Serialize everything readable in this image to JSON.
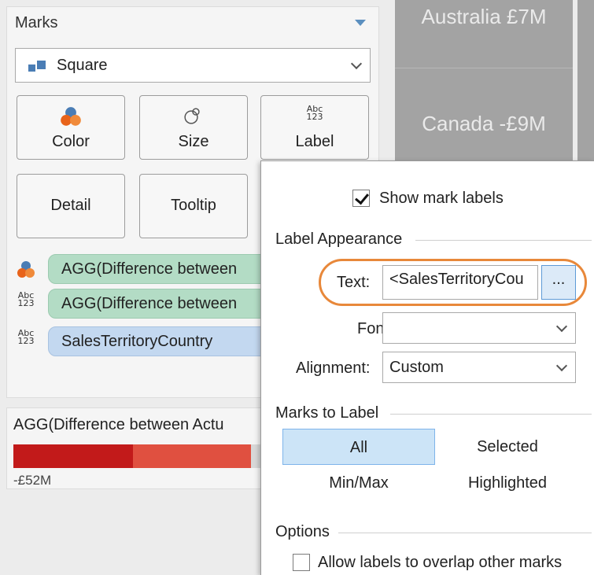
{
  "marks_card": {
    "title": "Marks",
    "mark_type": "Square",
    "buttons": {
      "color": "Color",
      "size": "Size",
      "label": "Label",
      "detail": "Detail",
      "tooltip": "Tooltip"
    },
    "pills": [
      "AGG(Difference between",
      "AGG(Difference between",
      "SalesTerritoryCountry"
    ]
  },
  "legend": {
    "title": "AGG(Difference between Actu",
    "min_label": "-£52M",
    "colors": [
      "#c21a1a",
      "#e05040",
      "#d8d8d8"
    ]
  },
  "view": {
    "tiles": [
      "Australia £7M",
      "Canada -£9M"
    ]
  },
  "popup": {
    "show_mark_labels": {
      "label": "Show mark labels",
      "checked": true
    },
    "label_appearance": {
      "heading": "Label Appearance",
      "text_label": "Text:",
      "text_value": "<SalesTerritoryCou",
      "ellipsis": "...",
      "font_label": "Font:",
      "font_value": "",
      "alignment_label": "Alignment:",
      "alignment_value": "Custom"
    },
    "marks_to_label": {
      "heading": "Marks to Label",
      "options": [
        "All",
        "Selected",
        "Min/Max",
        "Highlighted"
      ],
      "selected": "All"
    },
    "options": {
      "heading": "Options",
      "allow_overlap": {
        "label": "Allow labels to overlap other marks",
        "checked": false
      }
    }
  },
  "colors": {
    "highlight_oval": "#e8883a",
    "green_pill": "#b3dcc5",
    "blue_pill": "#c3d8f0",
    "header_arrow": "#5b8fbf"
  }
}
